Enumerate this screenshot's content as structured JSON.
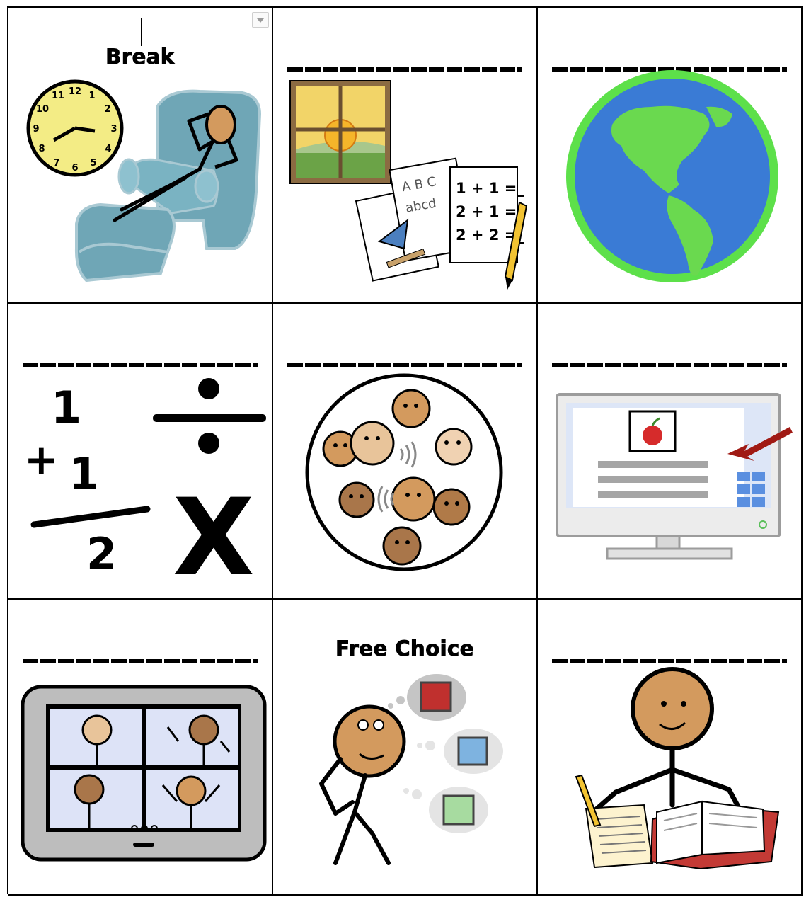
{
  "cells": [
    {
      "label": "Break",
      "has_label": true
    },
    {
      "label": "",
      "has_label": false
    },
    {
      "label": "",
      "has_label": false
    },
    {
      "label": "",
      "has_label": false
    },
    {
      "label": "",
      "has_label": false
    },
    {
      "label": "",
      "has_label": false
    },
    {
      "label": "",
      "has_label": false
    },
    {
      "label": "Free Choice",
      "has_label": true
    },
    {
      "label": "",
      "has_label": false
    }
  ],
  "worksheet": {
    "math_lines": [
      "1 + 1 =_",
      "2 + 1 =_",
      "2 + 2 =_"
    ],
    "abc": "A B C",
    "abcd": "abcd"
  },
  "math_symbols": {
    "top": "1",
    "plus": "+",
    "middle": "1",
    "result": "2",
    "times": "X"
  },
  "clock_numbers": [
    "12",
    "1",
    "2",
    "3",
    "4",
    "5",
    "6",
    "7",
    "8",
    "9",
    "10",
    "11"
  ],
  "colors": {
    "chair": "#6fa6b6",
    "skin": "#d39a5e",
    "earth_ocean": "#3a7bd5",
    "earth_land": "#6ad94f",
    "earth_ring": "#5de04a",
    "clock_face": "#f3ec85",
    "red_square": "#c0302e",
    "blue_square": "#7eb3e0",
    "green_square": "#a7dba0"
  }
}
